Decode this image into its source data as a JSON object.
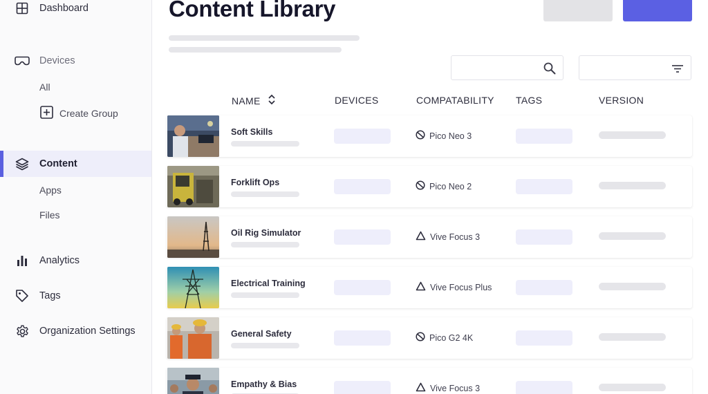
{
  "sidebar": {
    "dashboard": "Dashboard",
    "devices": "Devices",
    "devices_all": "All",
    "devices_create_group": "Create Group",
    "content": "Content",
    "content_apps": "Apps",
    "content_files": "Files",
    "analytics": "Analytics",
    "tags": "Tags",
    "organization_settings": "Organization Settings"
  },
  "header": {
    "title": "Content Library"
  },
  "table": {
    "columns": {
      "name": "NAME",
      "devices": "DEVICES",
      "compatability": "COMPATABILITY",
      "tags": "TAGS",
      "version": "VERSION"
    },
    "rows": [
      {
        "name": "Soft Skills",
        "compat": "Pico Neo 3",
        "compat_icon": "pico-icon"
      },
      {
        "name": "Forklift Ops",
        "compat": "Pico Neo 2",
        "compat_icon": "pico-icon"
      },
      {
        "name": "Oil Rig Simulator",
        "compat": "Vive Focus 3",
        "compat_icon": "vive-icon"
      },
      {
        "name": "Electrical Training",
        "compat": "Vive Focus Plus",
        "compat_icon": "vive-icon"
      },
      {
        "name": "General Safety",
        "compat": "Pico G2 4K",
        "compat_icon": "pico-icon"
      },
      {
        "name": "Empathy & Bias",
        "compat": "Vive Focus 3",
        "compat_icon": "vive-icon"
      }
    ]
  },
  "colors": {
    "accent": "#5b60e3",
    "active_bg": "#eeeefa"
  }
}
